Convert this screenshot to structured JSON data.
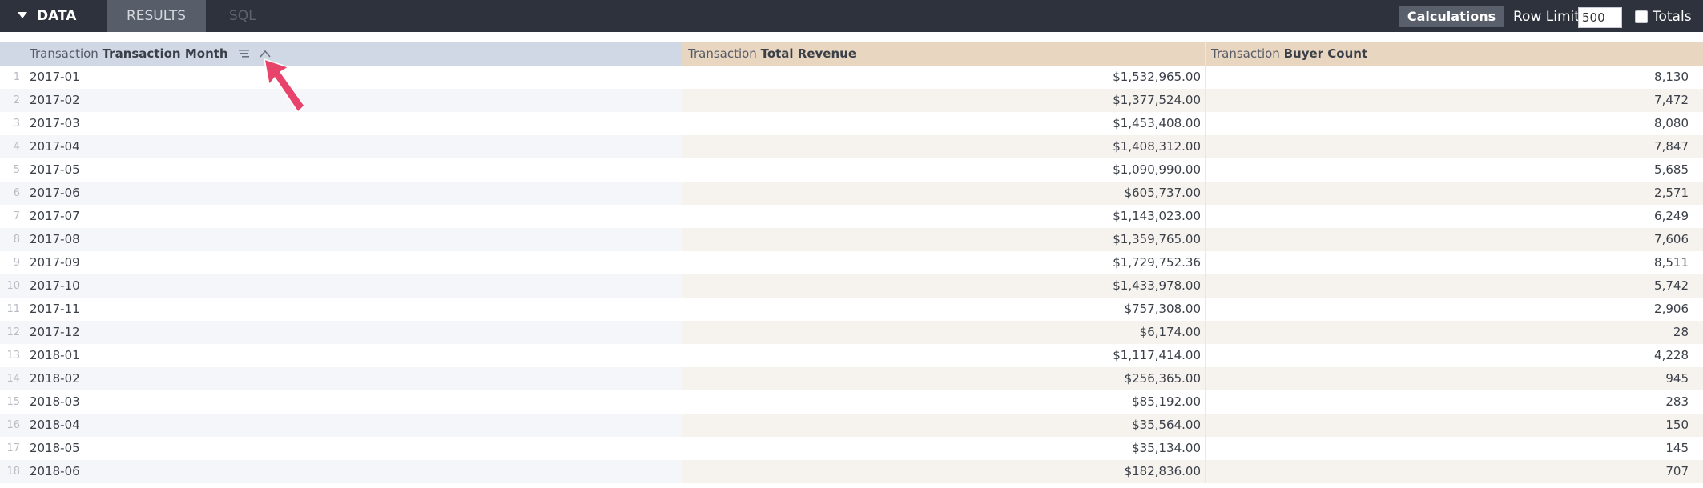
{
  "toolbar": {
    "tabs": [
      {
        "label": "DATA"
      },
      {
        "label": "RESULTS"
      },
      {
        "label": "SQL"
      }
    ],
    "calculations_label": "Calculations",
    "row_limit_label": "Row Limit",
    "row_limit_value": "500",
    "totals_label": "Totals"
  },
  "columns": [
    {
      "view": "Transaction",
      "field": "Transaction Month"
    },
    {
      "view": "Transaction",
      "field": "Total Revenue"
    },
    {
      "view": "Transaction",
      "field": "Buyer Count"
    }
  ],
  "rows": [
    {
      "num": "1",
      "month": "2017-01",
      "revenue": "$1,532,965.00",
      "buyers": "8,130"
    },
    {
      "num": "2",
      "month": "2017-02",
      "revenue": "$1,377,524.00",
      "buyers": "7,472"
    },
    {
      "num": "3",
      "month": "2017-03",
      "revenue": "$1,453,408.00",
      "buyers": "8,080"
    },
    {
      "num": "4",
      "month": "2017-04",
      "revenue": "$1,408,312.00",
      "buyers": "7,847"
    },
    {
      "num": "5",
      "month": "2017-05",
      "revenue": "$1,090,990.00",
      "buyers": "5,685"
    },
    {
      "num": "6",
      "month": "2017-06",
      "revenue": "$605,737.00",
      "buyers": "2,571"
    },
    {
      "num": "7",
      "month": "2017-07",
      "revenue": "$1,143,023.00",
      "buyers": "6,249"
    },
    {
      "num": "8",
      "month": "2017-08",
      "revenue": "$1,359,765.00",
      "buyers": "7,606"
    },
    {
      "num": "9",
      "month": "2017-09",
      "revenue": "$1,729,752.36",
      "buyers": "8,511"
    },
    {
      "num": "10",
      "month": "2017-10",
      "revenue": "$1,433,978.00",
      "buyers": "5,742"
    },
    {
      "num": "11",
      "month": "2017-11",
      "revenue": "$757,308.00",
      "buyers": "2,906"
    },
    {
      "num": "12",
      "month": "2017-12",
      "revenue": "$6,174.00",
      "buyers": "28"
    },
    {
      "num": "13",
      "month": "2018-01",
      "revenue": "$1,117,414.00",
      "buyers": "4,228"
    },
    {
      "num": "14",
      "month": "2018-02",
      "revenue": "$256,365.00",
      "buyers": "945"
    },
    {
      "num": "15",
      "month": "2018-03",
      "revenue": "$85,192.00",
      "buyers": "283"
    },
    {
      "num": "16",
      "month": "2018-04",
      "revenue": "$35,564.00",
      "buyers": "150"
    },
    {
      "num": "17",
      "month": "2018-05",
      "revenue": "$35,134.00",
      "buyers": "145"
    },
    {
      "num": "18",
      "month": "2018-06",
      "revenue": "$182,836.00",
      "buyers": "707"
    }
  ],
  "icons": {
    "caret": "caret-down-icon",
    "filter": "list-filter-icon",
    "sort": "chevron-up-icon",
    "pointer": "arrow-pointer-icon"
  },
  "colors": {
    "toolbar_bg": "#2d323d",
    "dimension_header": "#cfd8e4",
    "measure_header": "#e8d6c1",
    "annotation_arrow": "#e8436a"
  }
}
